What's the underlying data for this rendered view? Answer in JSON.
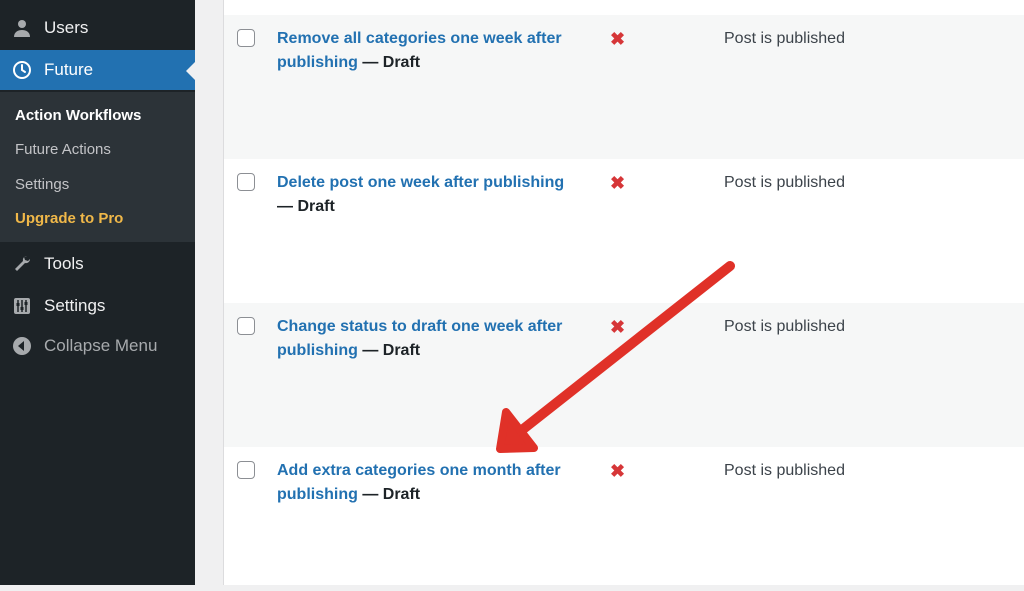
{
  "sidebar": {
    "users": "Users",
    "future": "Future",
    "submenu": {
      "action_workflows": "Action Workflows",
      "future_actions": "Future Actions",
      "settings": "Settings",
      "upgrade": "Upgrade to Pro"
    },
    "tools": "Tools",
    "settings": "Settings",
    "collapse": "Collapse Menu"
  },
  "rows": [
    {
      "title": "Remove all categories one week after publishing",
      "state": "— Draft",
      "x": "✖",
      "status": "Post is published"
    },
    {
      "title": "Delete post one week after publishing",
      "state": "— Draft",
      "x": "✖",
      "status": "Post is published"
    },
    {
      "title": "Change status to draft one week after publishing",
      "state": "— Draft",
      "x": "✖",
      "status": "Post is published"
    },
    {
      "title": "Add extra categories one month after publishing",
      "state": "— Draft",
      "x": "✖",
      "status": "Post is published"
    }
  ],
  "colors": {
    "accent": "#2271b1",
    "sidebar": "#1d2327",
    "pro": "#f0b849",
    "error": "#d63638",
    "annotation": "#e03128"
  }
}
